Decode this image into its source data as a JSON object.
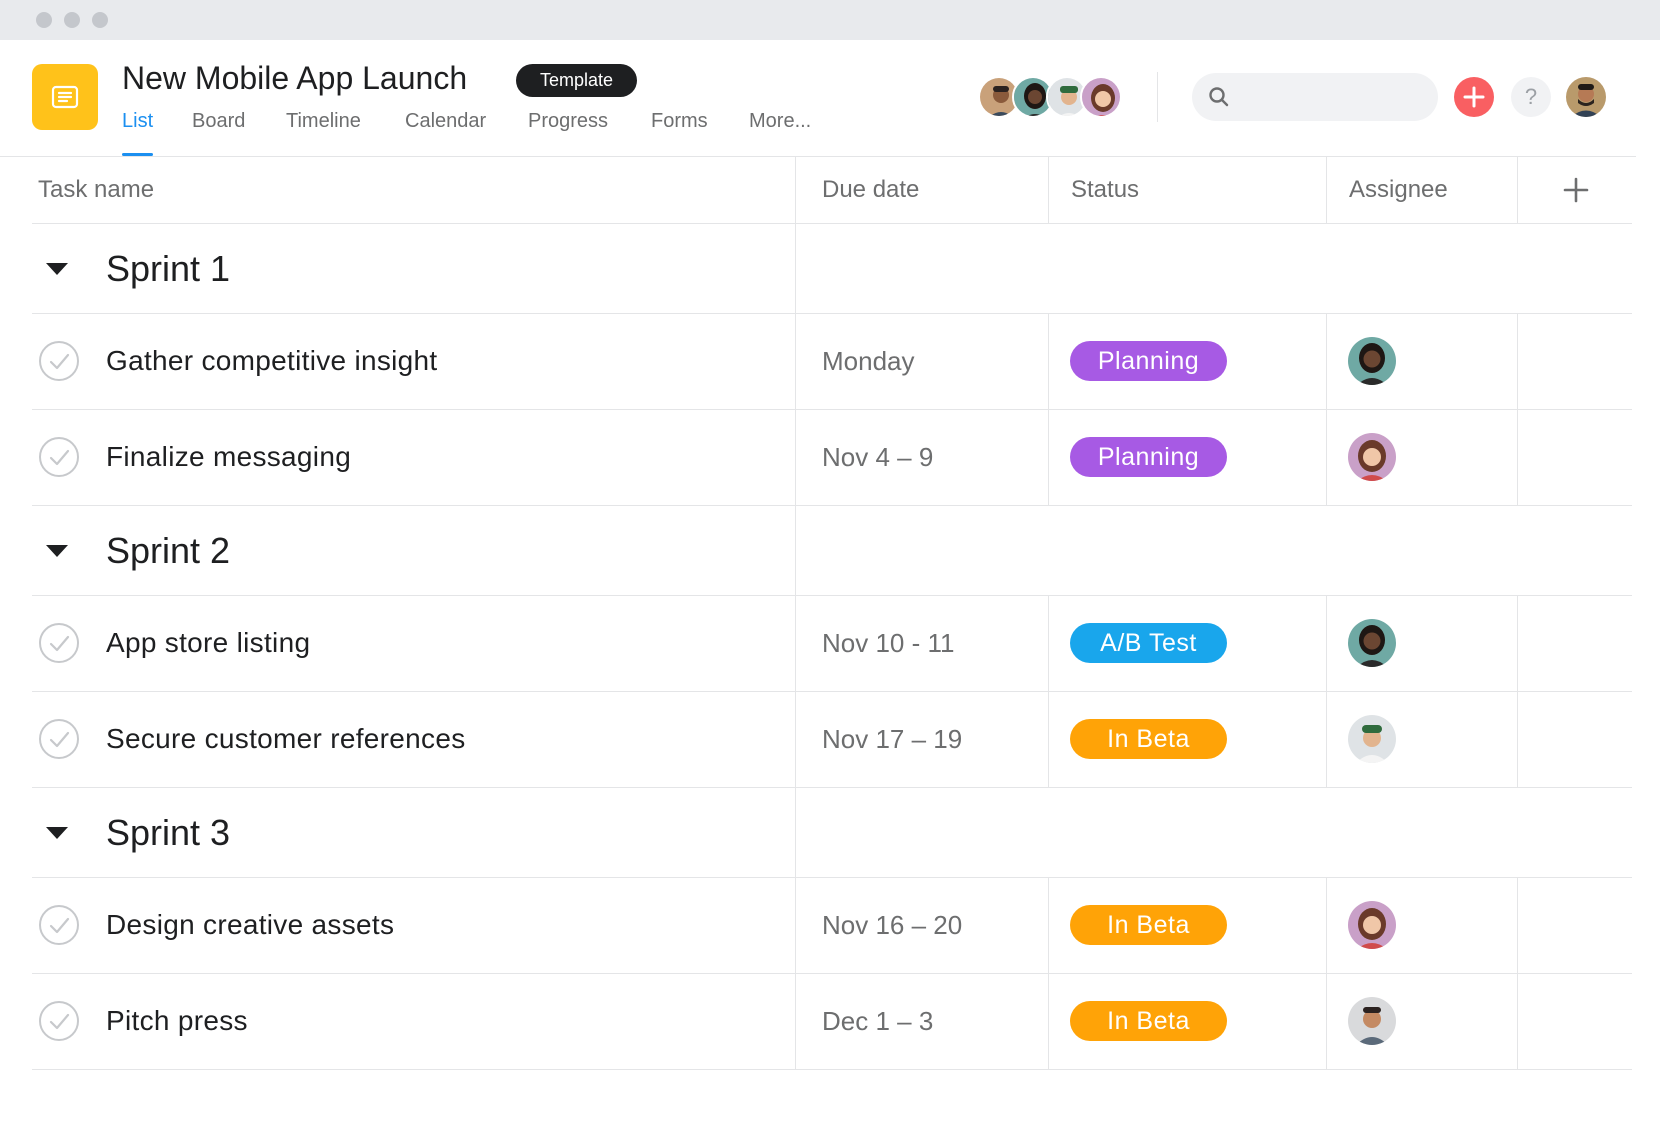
{
  "project": {
    "title": "New Mobile App Launch",
    "badge": "Template",
    "icon": "list-icon"
  },
  "tabs": [
    {
      "label": "List",
      "active": true
    },
    {
      "label": "Board",
      "active": false
    },
    {
      "label": "Timeline",
      "active": false
    },
    {
      "label": "Calendar",
      "active": false
    },
    {
      "label": "Progress",
      "active": false
    },
    {
      "label": "Forms",
      "active": false
    },
    {
      "label": "More...",
      "active": false
    }
  ],
  "topbar": {
    "search_placeholder": "",
    "add_icon": "plus-icon",
    "help_label": "?"
  },
  "columns": {
    "task": "Task name",
    "due": "Due date",
    "status": "Status",
    "assignee": "Assignee"
  },
  "colors": {
    "accent": "#1b8ff0",
    "app_icon": "#ffc21a",
    "add_button": "#f95f62",
    "planning": "#a75ae4",
    "ab_test": "#19a6ec",
    "in_beta": "#ffa307"
  },
  "sections": [
    {
      "title": "Sprint 1",
      "tasks": [
        {
          "name": "Gather competitive insight",
          "due": "Monday",
          "status": "Planning"
        },
        {
          "name": "Finalize messaging",
          "due": "Nov 4 – 9",
          "status": "Planning"
        }
      ]
    },
    {
      "title": "Sprint 2",
      "tasks": [
        {
          "name": "App store listing",
          "due": "Nov 10 - 11",
          "status": "A/B Test"
        },
        {
          "name": "Secure customer references",
          "due": "Nov 17 – 19",
          "status": "In Beta"
        }
      ]
    },
    {
      "title": "Sprint 3",
      "tasks": [
        {
          "name": "Design creative assets",
          "due": "Nov 16 – 20",
          "status": "In Beta"
        },
        {
          "name": "Pitch press",
          "due": "Dec 1 – 3",
          "status": "In Beta"
        }
      ]
    }
  ]
}
